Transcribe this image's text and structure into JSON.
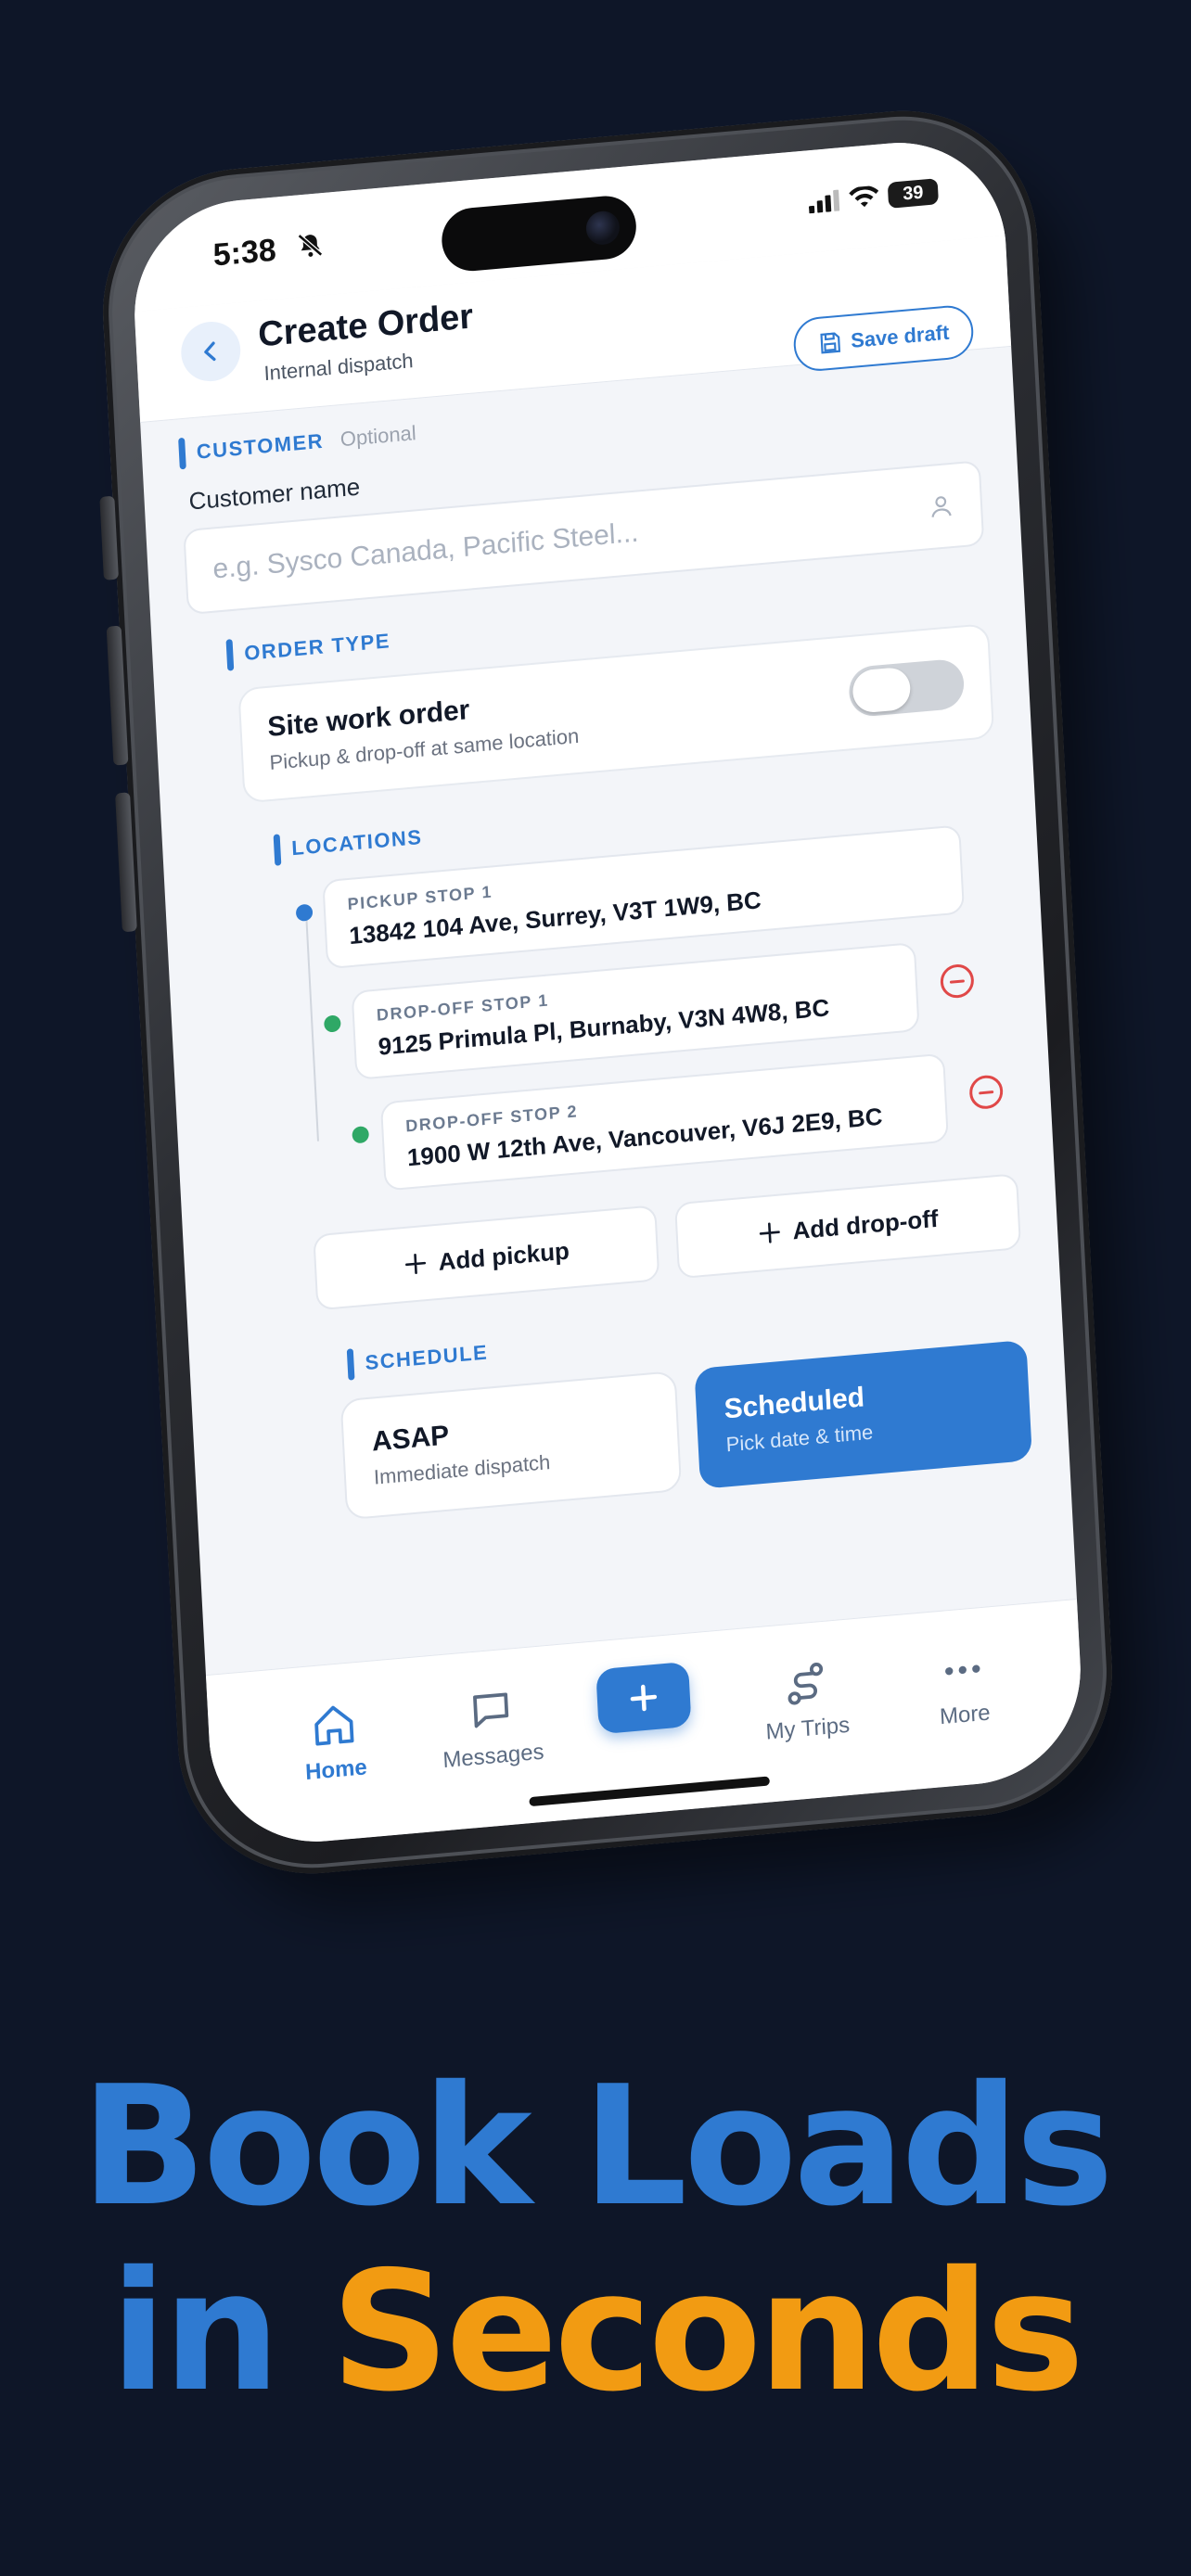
{
  "status_bar": {
    "time": "5:38",
    "battery": "39"
  },
  "header": {
    "title": "Create Order",
    "subtitle": "Internal dispatch",
    "save_label": "Save draft"
  },
  "customer": {
    "section_label": "CUSTOMER",
    "optional_label": "Optional",
    "field_label": "Customer name",
    "placeholder": "e.g. Sysco Canada, Pacific Steel...",
    "value": ""
  },
  "order_type": {
    "section_label": "ORDER TYPE",
    "title": "Site work order",
    "subtitle": "Pickup & drop-off at same location",
    "enabled": false
  },
  "locations": {
    "section_label": "LOCATIONS",
    "stops": [
      {
        "kind": "PICKUP STOP 1",
        "address": "13842 104 Ave, Surrey, V3T 1W9, BC",
        "color": "#2f7ad1",
        "removable": false
      },
      {
        "kind": "DROP-OFF STOP 1",
        "address": "9125 Primula Pl, Burnaby, V3N 4W8, BC",
        "color": "#2fa866",
        "removable": true
      },
      {
        "kind": "DROP-OFF STOP 2",
        "address": "1900 W 12th Ave, Vancouver, V6J 2E9, BC",
        "color": "#2fa866",
        "removable": true
      }
    ],
    "add_pickup": "Add pickup",
    "add_dropoff": "Add drop-off"
  },
  "schedule": {
    "section_label": "SCHEDULE",
    "options": [
      {
        "title": "ASAP",
        "subtitle": "Immediate dispatch",
        "selected": false
      },
      {
        "title": "Scheduled",
        "subtitle": "Pick date & time",
        "selected": true
      }
    ]
  },
  "tabbar": {
    "home": "Home",
    "messages": "Messages",
    "trips": "My Trips",
    "more": "More"
  },
  "headline": {
    "line1": "Book Loads",
    "line2_a": "in",
    "line2_b": "Seconds"
  },
  "colors": {
    "accent": "#2f7ad1",
    "highlight": "#f29b12",
    "background": "#0e1628",
    "dropoff": "#2fa866",
    "danger": "#e04848"
  }
}
